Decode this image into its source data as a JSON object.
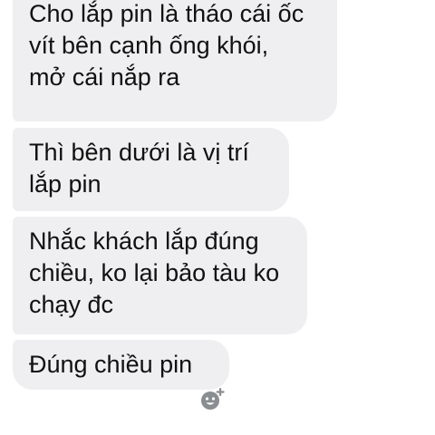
{
  "messages": [
    {
      "text": "Cho lắp pin là tháo cái ốc\nvít bên cạnh ống khói,\nmở cái nắp ra"
    },
    {
      "text": "Thì bên dưới là vị trí\nlắp pin"
    },
    {
      "text": "Nhắc khách lắp đúng\nchiều, ko lại bảo tàu ko\nchạy đc"
    },
    {
      "text": "Đúng chiều pin"
    }
  ],
  "reaction": {
    "icon": "add-reaction-smiley-icon"
  },
  "colors": {
    "bubble": "#efeff1",
    "text": "#111111",
    "icon": "#8a8d91"
  }
}
